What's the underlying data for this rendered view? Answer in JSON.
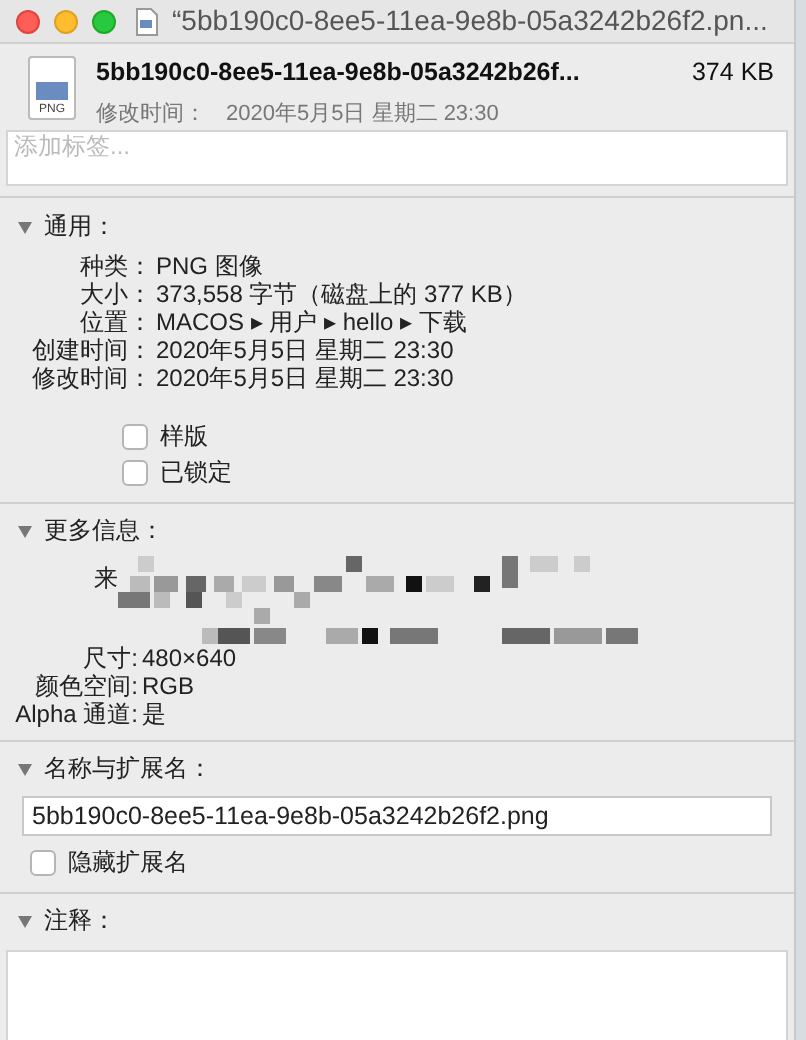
{
  "window": {
    "title": "“5bb190c0-8ee5-11ea-9e8b-05a3242b26f2.pn..."
  },
  "header": {
    "file_name": "5bb190c0-8ee5-11ea-9e8b-05a3242b26f...",
    "size": "374 KB",
    "modified_label": "修改时间：",
    "modified_value": "2020年5月5日 星期二 23:30",
    "icon_label": "PNG"
  },
  "tags": {
    "placeholder": "添加标签..."
  },
  "general": {
    "title": "通用：",
    "expanded": true,
    "rows": [
      {
        "label": "种类：",
        "value": "PNG 图像"
      },
      {
        "label": "大小：",
        "value": "373,558 字节（磁盘上的 377 KB）"
      },
      {
        "label": "位置：",
        "value": "MACOS ▸ 用户 ▸ hello ▸ 下载"
      },
      {
        "label": "创建时间：",
        "value": "2020年5月5日 星期二 23:30"
      },
      {
        "label": "修改时间：",
        "value": "2020年5月5日 星期二 23:30"
      }
    ],
    "checkboxes": [
      {
        "label": "样版",
        "checked": false
      },
      {
        "label": "已锁定",
        "checked": false
      }
    ]
  },
  "more_info": {
    "title": "更多信息：",
    "expanded": true,
    "source_label": "来",
    "rows": [
      {
        "label": "尺寸:",
        "value": "480×640"
      },
      {
        "label": "颜色空间:",
        "value": "RGB"
      },
      {
        "label": "Alpha 通道:",
        "value": "是"
      }
    ]
  },
  "name_ext": {
    "title": "名称与扩展名：",
    "expanded": true,
    "value": "5bb190c0-8ee5-11ea-9e8b-05a3242b26f2.png",
    "hide_extension": {
      "label": "隐藏扩展名",
      "checked": false
    }
  },
  "comments": {
    "title": "注释：",
    "expanded": true
  }
}
